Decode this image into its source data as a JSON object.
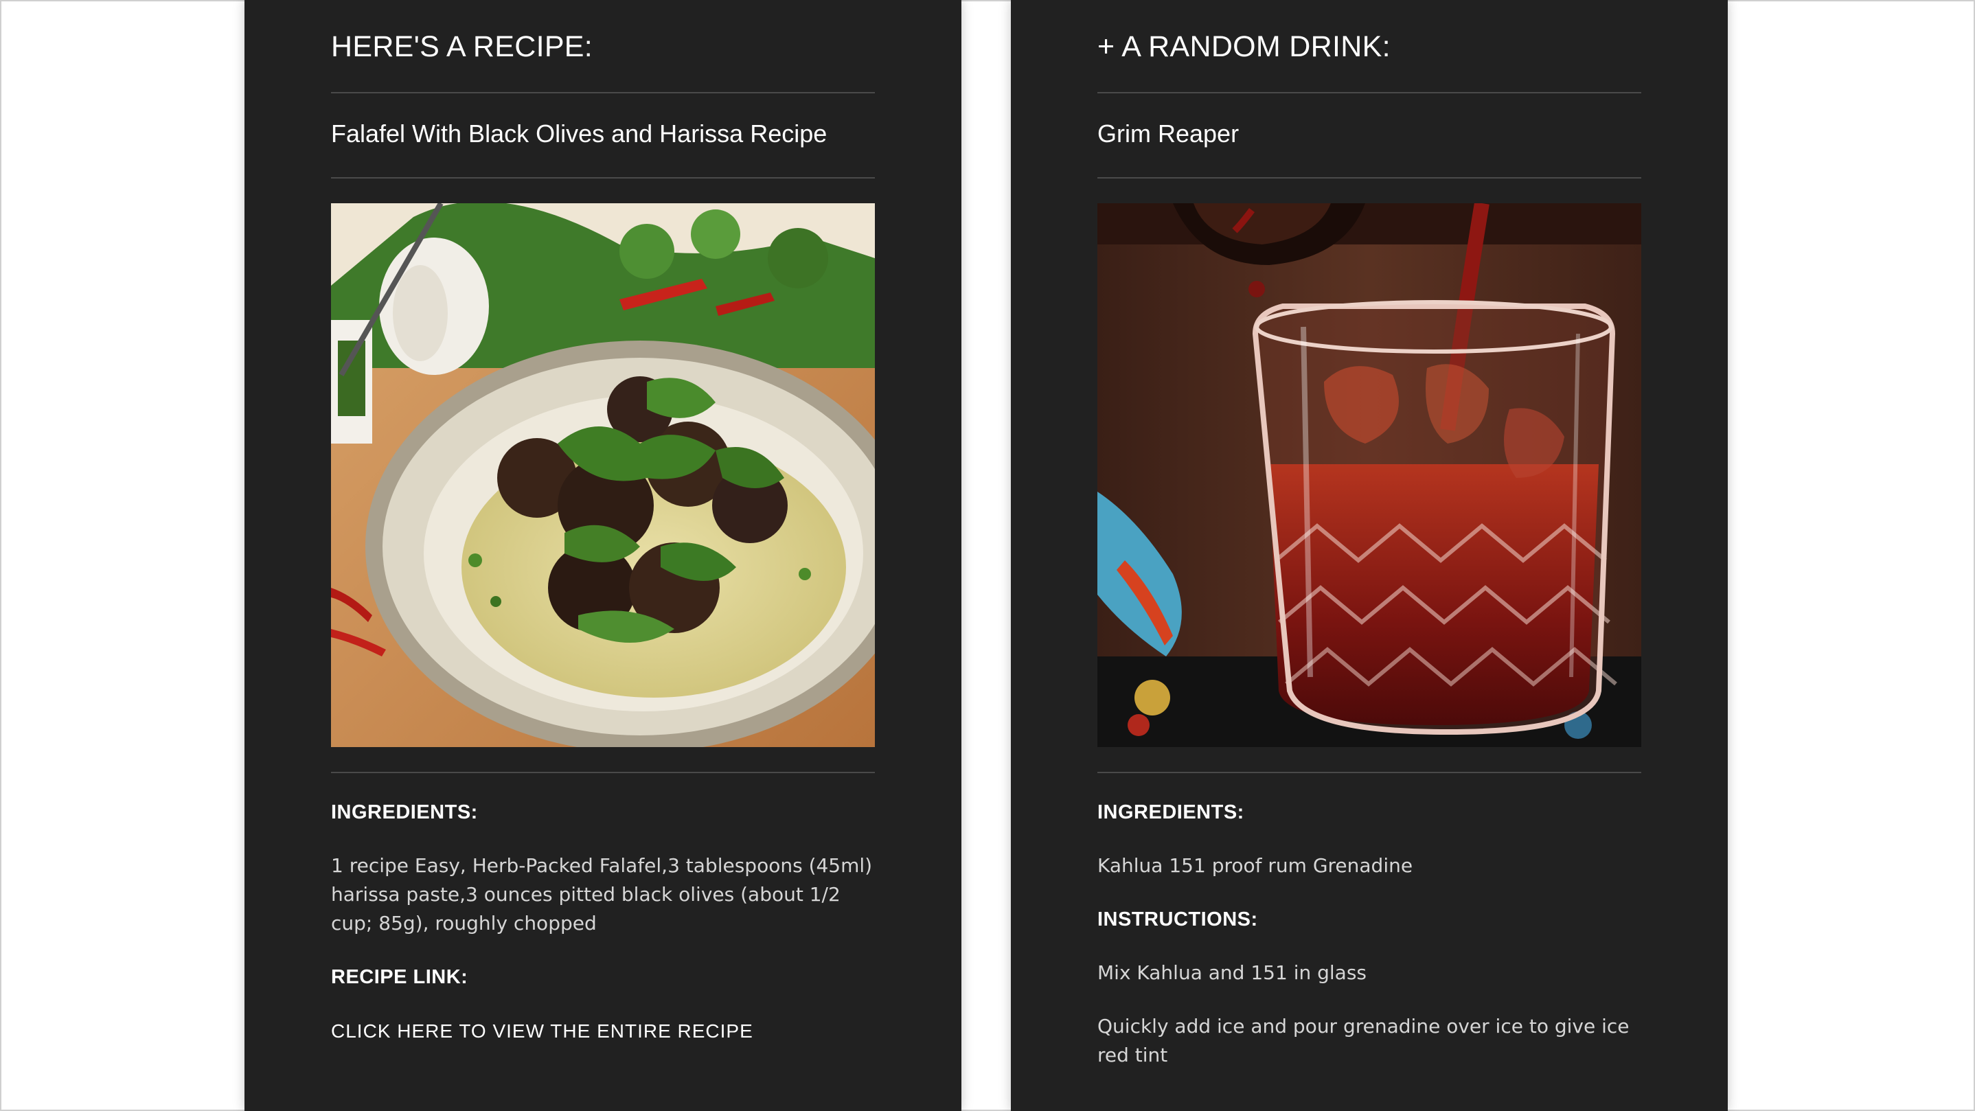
{
  "recipe_card": {
    "heading": "HERE'S A RECIPE:",
    "title": "Falafel With Black Olives and Harissa Recipe",
    "image_icon": "falafel-photo",
    "ingredients_label": "INGREDIENTS:",
    "ingredients_text": "1 recipe Easy, Herb-Packed Falafel,3 tablespoons (45ml) harissa paste,3 ounces pitted black olives (about 1/2 cup; 85g), roughly chopped",
    "recipe_link_label": "RECIPE LINK:",
    "recipe_link_text": "CLICK HERE TO VIEW THE ENTIRE RECIPE"
  },
  "drink_card": {
    "heading": "+ A RANDOM DRINK:",
    "title": "Grim Reaper",
    "image_icon": "cocktail-photo",
    "ingredients_label": "INGREDIENTS:",
    "ingredients_text": "Kahlua 151 proof rum Grenadine",
    "instructions_label": "INSTRUCTIONS:",
    "instructions": [
      "Mix Kahlua and 151 in glass",
      "Quickly add ice and pour grenadine over ice to give ice red tint"
    ]
  },
  "colors": {
    "page_background": "#ffffff",
    "card_background": "#212121",
    "divider": "#4a4a4a",
    "heading_text": "#ffffff",
    "body_text": "#d6d6d6"
  }
}
